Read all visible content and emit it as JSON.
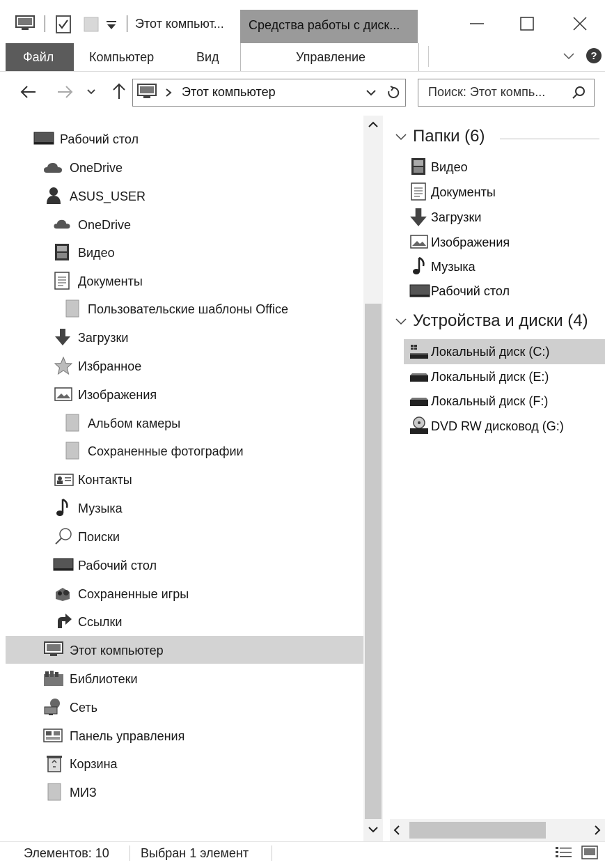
{
  "window": {
    "title": "Этот компьют...",
    "context_tab": "Средства работы с диск..."
  },
  "ribbon": {
    "tabs": [
      "Файл",
      "Компьютер",
      "Вид",
      "Управление"
    ]
  },
  "address": {
    "path": "Этот компьютер",
    "search_placeholder": "Поиск: Этот компь..."
  },
  "nav": [
    {
      "label": "Рабочий стол",
      "icon": "desktop-icon"
    },
    {
      "label": "OneDrive",
      "icon": "cloud-icon"
    },
    {
      "label": "ASUS_USER",
      "icon": "user-icon"
    },
    {
      "label": "OneDrive",
      "icon": "cloud-icon"
    },
    {
      "label": "Видео",
      "icon": "video-icon"
    },
    {
      "label": "Документы",
      "icon": "document-icon"
    },
    {
      "label": "Пользовательские шаблоны Office",
      "icon": "folder-icon"
    },
    {
      "label": "Загрузки",
      "icon": "download-icon"
    },
    {
      "label": "Избранное",
      "icon": "star-icon"
    },
    {
      "label": "Изображения",
      "icon": "pictures-icon"
    },
    {
      "label": "Альбом камеры",
      "icon": "folder-icon"
    },
    {
      "label": "Сохраненные фотографии",
      "icon": "folder-icon"
    },
    {
      "label": "Контакты",
      "icon": "contacts-icon"
    },
    {
      "label": "Музыка",
      "icon": "music-icon"
    },
    {
      "label": "Поиски",
      "icon": "search-icon"
    },
    {
      "label": "Рабочий стол",
      "icon": "desktop-icon"
    },
    {
      "label": "Сохраненные игры",
      "icon": "games-icon"
    },
    {
      "label": "Ссылки",
      "icon": "link-icon"
    },
    {
      "label": "Этот компьютер",
      "icon": "computer-icon",
      "selected": true
    },
    {
      "label": "Библиотеки",
      "icon": "libraries-icon"
    },
    {
      "label": "Сеть",
      "icon": "network-icon"
    },
    {
      "label": "Панель управления",
      "icon": "control-panel-icon"
    },
    {
      "label": "Корзина",
      "icon": "recycle-bin-icon"
    },
    {
      "label": "МИЗ",
      "icon": "folder-icon"
    }
  ],
  "content": {
    "folders_header": "Папки (6)",
    "folders": [
      {
        "label": "Видео",
        "icon": "video-icon"
      },
      {
        "label": "Документы",
        "icon": "document-icon"
      },
      {
        "label": "Загрузки",
        "icon": "download-icon"
      },
      {
        "label": "Изображения",
        "icon": "pictures-icon"
      },
      {
        "label": "Музыка",
        "icon": "music-icon"
      },
      {
        "label": "Рабочий стол",
        "icon": "desktop-icon"
      }
    ],
    "devices_header": "Устройства и диски (4)",
    "devices": [
      {
        "label": "Локальный диск (C:)",
        "icon": "system-drive-icon",
        "selected": true
      },
      {
        "label": "Локальный диск (E:)",
        "icon": "drive-icon"
      },
      {
        "label": "Локальный диск (F:)",
        "icon": "drive-icon"
      },
      {
        "label": "DVD RW дисковод (G:)",
        "icon": "dvd-drive-icon"
      }
    ]
  },
  "status": {
    "items_count": "Элементов: 10",
    "selected": "Выбран 1 элемент"
  }
}
